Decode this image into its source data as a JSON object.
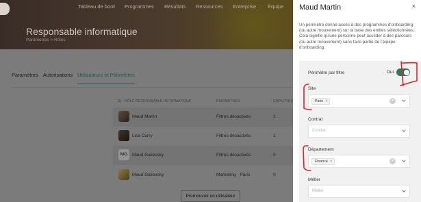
{
  "topnav": {
    "items": [
      "Tableau de bord",
      "Programmes",
      "Résultats",
      "Ressources",
      "Entreprise",
      "Équipe"
    ]
  },
  "hero": {
    "title": "Responsable informatique",
    "breadcrumb": "Paramètres > Rôles"
  },
  "tabs": [
    {
      "label": "Paramètres",
      "active": false
    },
    {
      "label": "Autorisations",
      "active": false
    },
    {
      "label": "Utilisateurs et Périmètres",
      "active": true
    }
  ],
  "table": {
    "headers": {
      "role": "RÔLE RESPONSABLE INFORMATIQUE",
      "perimeters": "PÉRIMÈTRES",
      "employees": "EMPLOYÉS"
    },
    "rows": [
      {
        "name": "Maud Martin",
        "perimeters": "Filtres désactivés",
        "employees": "2",
        "avatar": "photo",
        "highlighted": true
      },
      {
        "name": "Lisa Curry",
        "perimeters": "Filtres désactivés",
        "employees": "1",
        "avatar": "photo",
        "highlighted": false
      },
      {
        "name": "Maud Galievsky",
        "perimeters": "Filtres désactivés",
        "employees": "0",
        "avatar": "MG",
        "highlighted": true
      },
      {
        "name": "Maud Galievsky",
        "perimeters": "Marketing · Paris",
        "employees": "0",
        "avatar": "photo",
        "highlighted": false
      }
    ]
  },
  "promote_button": "Promouvoir un utilisateur",
  "panel": {
    "title": "Maud Martin",
    "close": "×",
    "description": "Un périmètre donne accès à des programmes d'onboarding (ou autre mouvement) sur la base des entités sélectionnées. Cela signifie qu'une personne peut accéder à des parcours (ou autre mouvement) sans faire partie de l'équipe d'onboarding.",
    "filter_label": "Périmètre par filtre",
    "toggle_label": "Oui",
    "toggle_on": true,
    "fields": [
      {
        "label": "Site",
        "chips": [
          "Paris"
        ],
        "placeholder": ""
      },
      {
        "label": "Contrat",
        "chips": [],
        "placeholder": "Contrat"
      },
      {
        "label": "Département",
        "chips": [
          "Finance"
        ],
        "placeholder": ""
      },
      {
        "label": "Métier",
        "chips": [],
        "placeholder": "Métier"
      }
    ]
  },
  "colors": {
    "accent": "#2f7a5f",
    "annotation": "#d9262b"
  }
}
